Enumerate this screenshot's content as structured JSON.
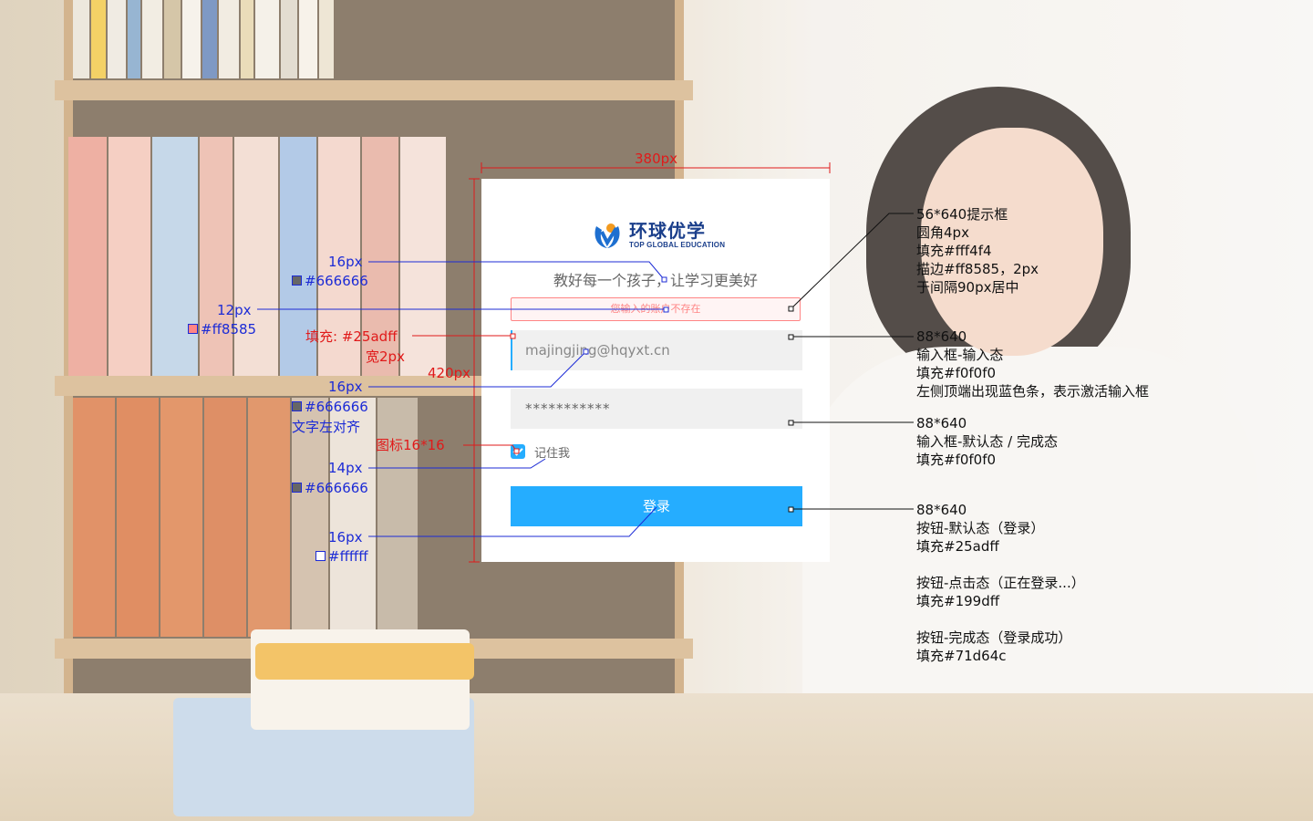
{
  "card": {
    "logo_cn": "环球优学",
    "logo_en": "TOP GLOBAL EDUCATION",
    "slogan": "教好每一个孩子，让学习更美好",
    "error_text": "您输入的账户不存在",
    "username_value": "majingjing@hqyxt.cn",
    "password_value": "***********",
    "remember_label": "记住我",
    "login_label": "登录"
  },
  "annotations": {
    "width_label": "380px",
    "height_label": "420px",
    "slogan_size": "16px",
    "slogan_color": "#666666",
    "error_size": "12px",
    "error_color": "#ff8585",
    "bar_fill": "填充: #25adff",
    "bar_width": "宽2px",
    "input_size": "16px",
    "input_color": "#666666",
    "input_align": "文字左对齐",
    "icon_size": "图标16*16",
    "remember_size": "14px",
    "remember_color": "#666666",
    "button_size": "16px",
    "button_color": "#ffffff"
  },
  "notes": {
    "error_box": [
      "56*640提示框",
      "圆角4px",
      "填充#fff4f4",
      "描边#ff8585，2px",
      "于间隔90px居中"
    ],
    "input_active": [
      "88*640",
      "输入框-输入态",
      "填充#f0f0f0",
      "左侧顶端出现蓝色条，表示激活输入框"
    ],
    "input_default": [
      "88*640",
      "输入框-默认态 / 完成态",
      "填充#f0f0f0"
    ],
    "button": [
      "88*640",
      "按钮-默认态（登录）",
      "填充#25adff",
      "",
      "按钮-点击态（正在登录...）",
      "填充#199dff",
      "",
      "按钮-完成态（登录成功）",
      "填充#71d64c"
    ]
  },
  "colors": {
    "primary": "#25adff",
    "input_bg": "#f0f0f0",
    "error_bg": "#fff4f4",
    "error_border": "#ff8585",
    "text_gray": "#666666",
    "annotation_blue": "#1c2bd6",
    "annotation_red": "#e01a1a"
  }
}
